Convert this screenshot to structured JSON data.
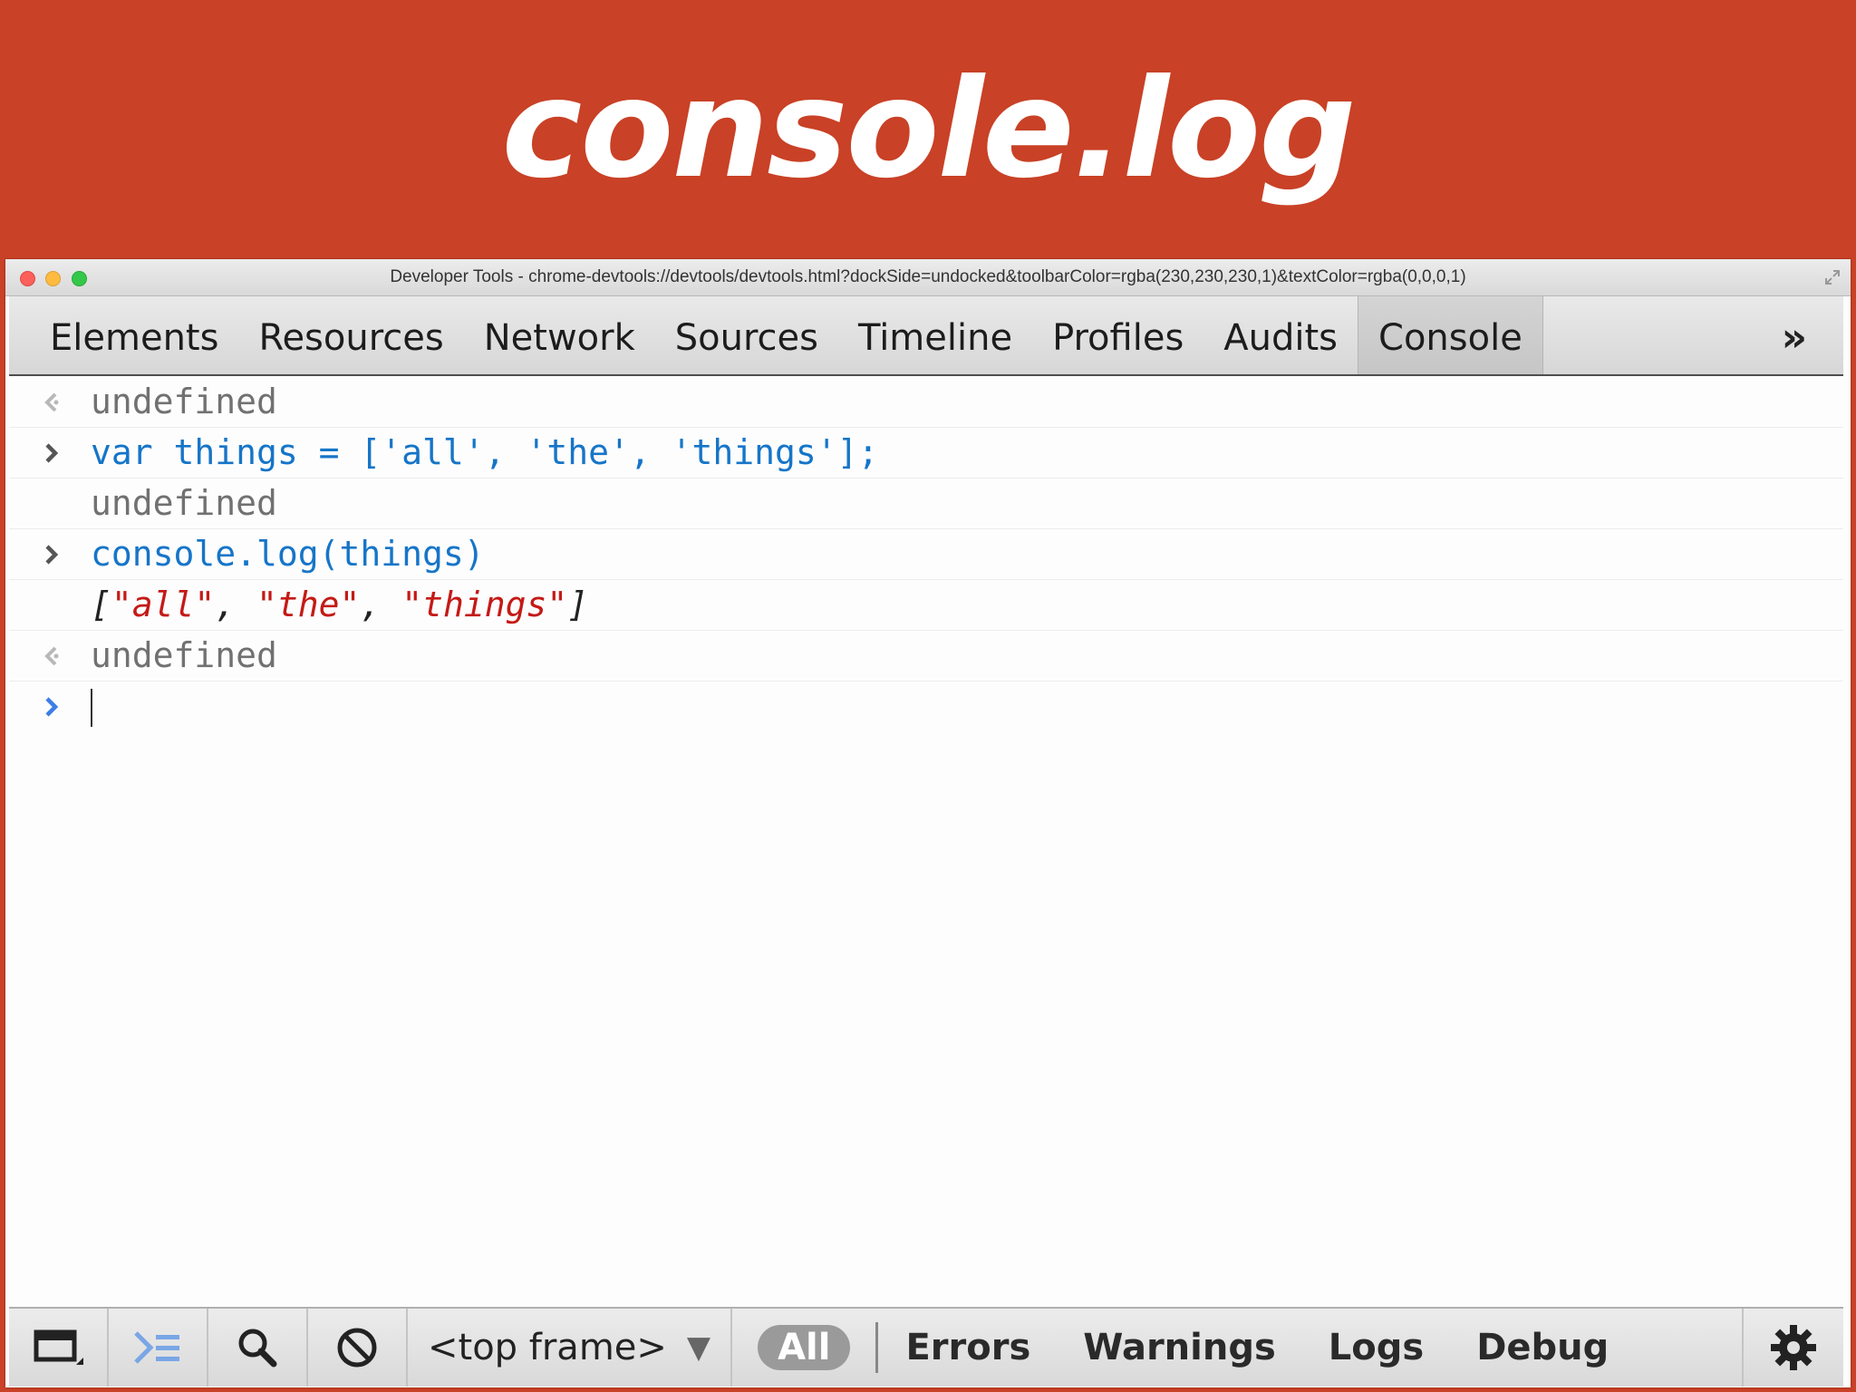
{
  "slide": {
    "title": "console.log"
  },
  "window": {
    "title": "Developer Tools - chrome-devtools://devtools/devtools.html?dockSide=undocked&toolbarColor=rgba(230,230,230,1)&textColor=rgba(0,0,0,1)"
  },
  "tabs": [
    {
      "label": "Elements"
    },
    {
      "label": "Resources"
    },
    {
      "label": "Network"
    },
    {
      "label": "Sources"
    },
    {
      "label": "Timeline"
    },
    {
      "label": "Profiles"
    },
    {
      "label": "Audits"
    },
    {
      "label": "Console",
      "active": true
    }
  ],
  "tabs_more": "»",
  "console": {
    "lines": [
      {
        "kind": "result",
        "gutter_icon": "result-arrow-icon",
        "text": "undefined"
      },
      {
        "kind": "input",
        "gutter_icon": "prompt-chevron-icon",
        "text": "var things = ['all', 'the', 'things'];"
      },
      {
        "kind": "result",
        "gutter_icon": "",
        "text": "undefined"
      },
      {
        "kind": "input",
        "gutter_icon": "prompt-chevron-icon",
        "text": "console.log(things)"
      },
      {
        "kind": "log",
        "gutter_icon": "",
        "text": "[\"all\", \"the\", \"things\"]",
        "tokens": [
          "[",
          "\"all\"",
          ", ",
          "\"the\"",
          ", ",
          "\"things\"",
          "]"
        ]
      },
      {
        "kind": "result",
        "gutter_icon": "result-arrow-icon",
        "text": "undefined"
      }
    ],
    "prompt_value": ""
  },
  "bottombar": {
    "frame_selector": "<top frame>",
    "filters": [
      "All",
      "Errors",
      "Warnings",
      "Logs",
      "Debug"
    ],
    "active_filter": "All"
  },
  "colors": {
    "slide_background": "#c94126",
    "input_text": "#1675c8",
    "string_text": "#c41a16",
    "result_text": "#717171"
  }
}
